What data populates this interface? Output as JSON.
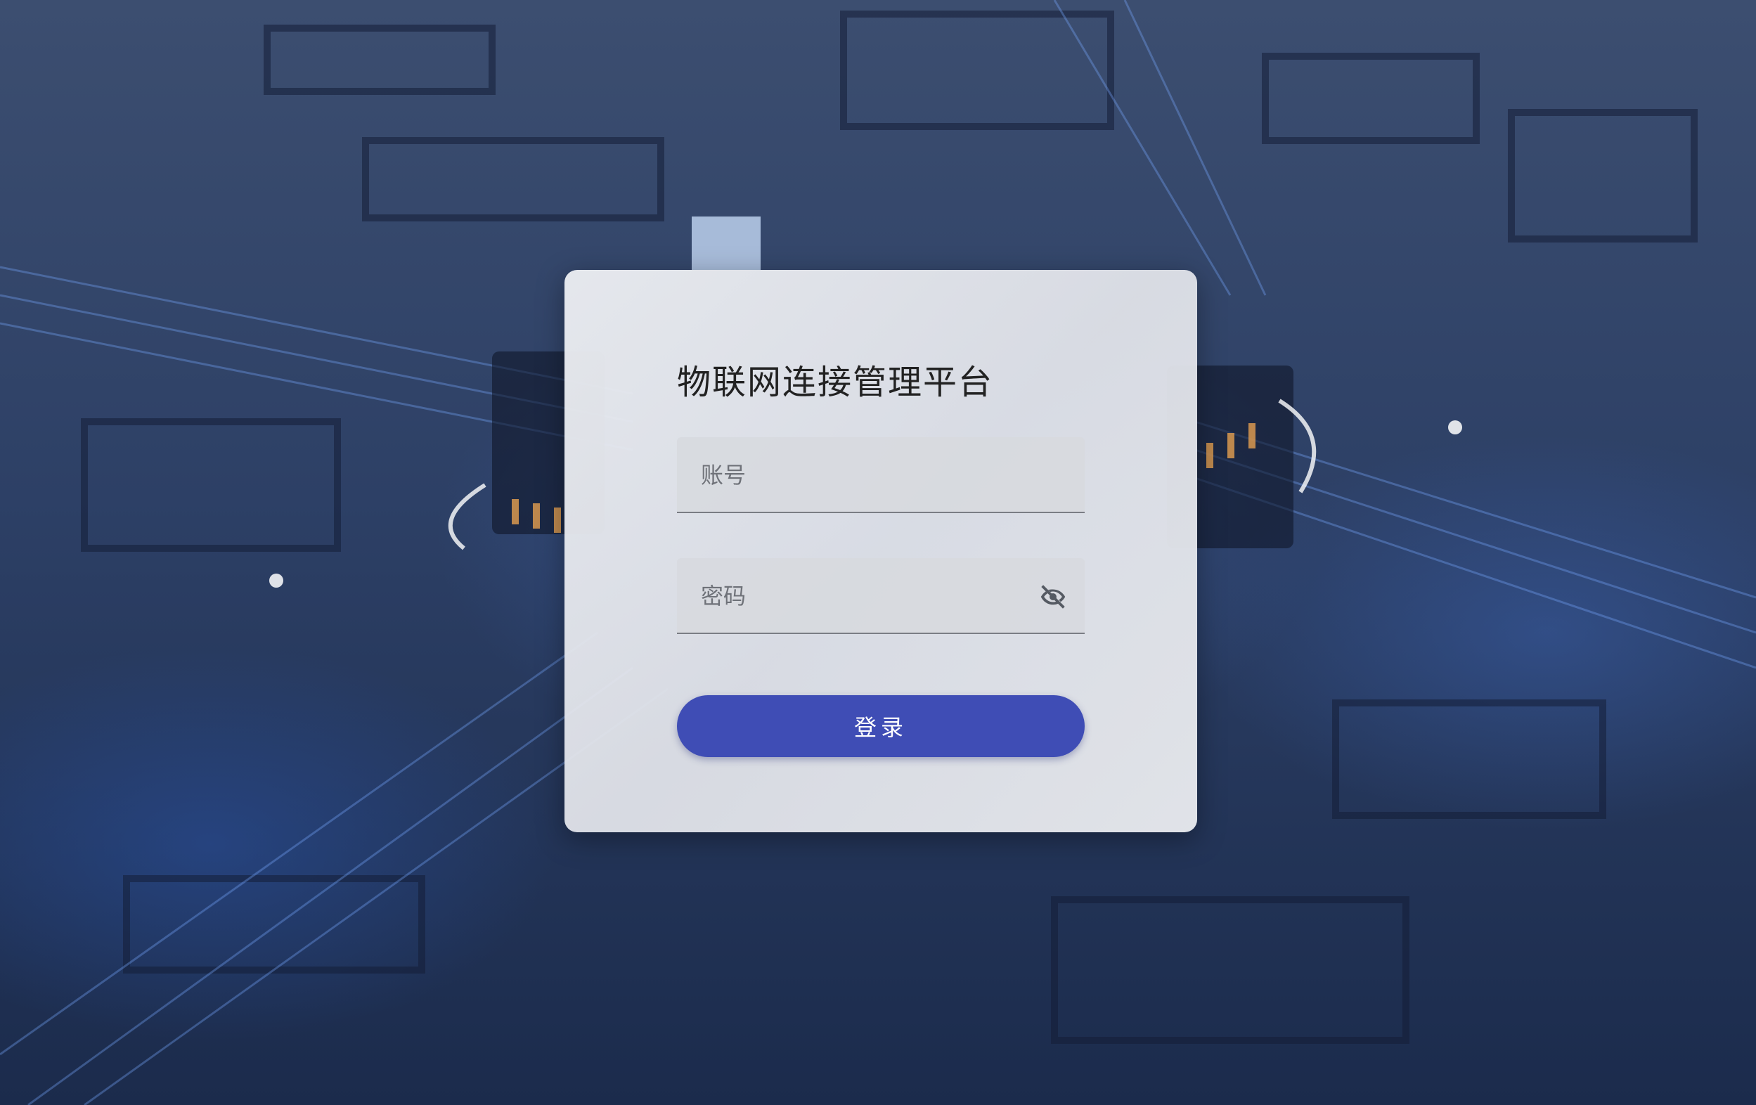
{
  "app": {
    "title": "物联网连接管理平台"
  },
  "login_form": {
    "account_placeholder": "账号",
    "password_placeholder": "密码",
    "login_label": "登录",
    "password_visibility_icon": "eye-off-icon"
  },
  "theme": {
    "button_color": "#3f4db5",
    "background_color": "#2d4066"
  }
}
